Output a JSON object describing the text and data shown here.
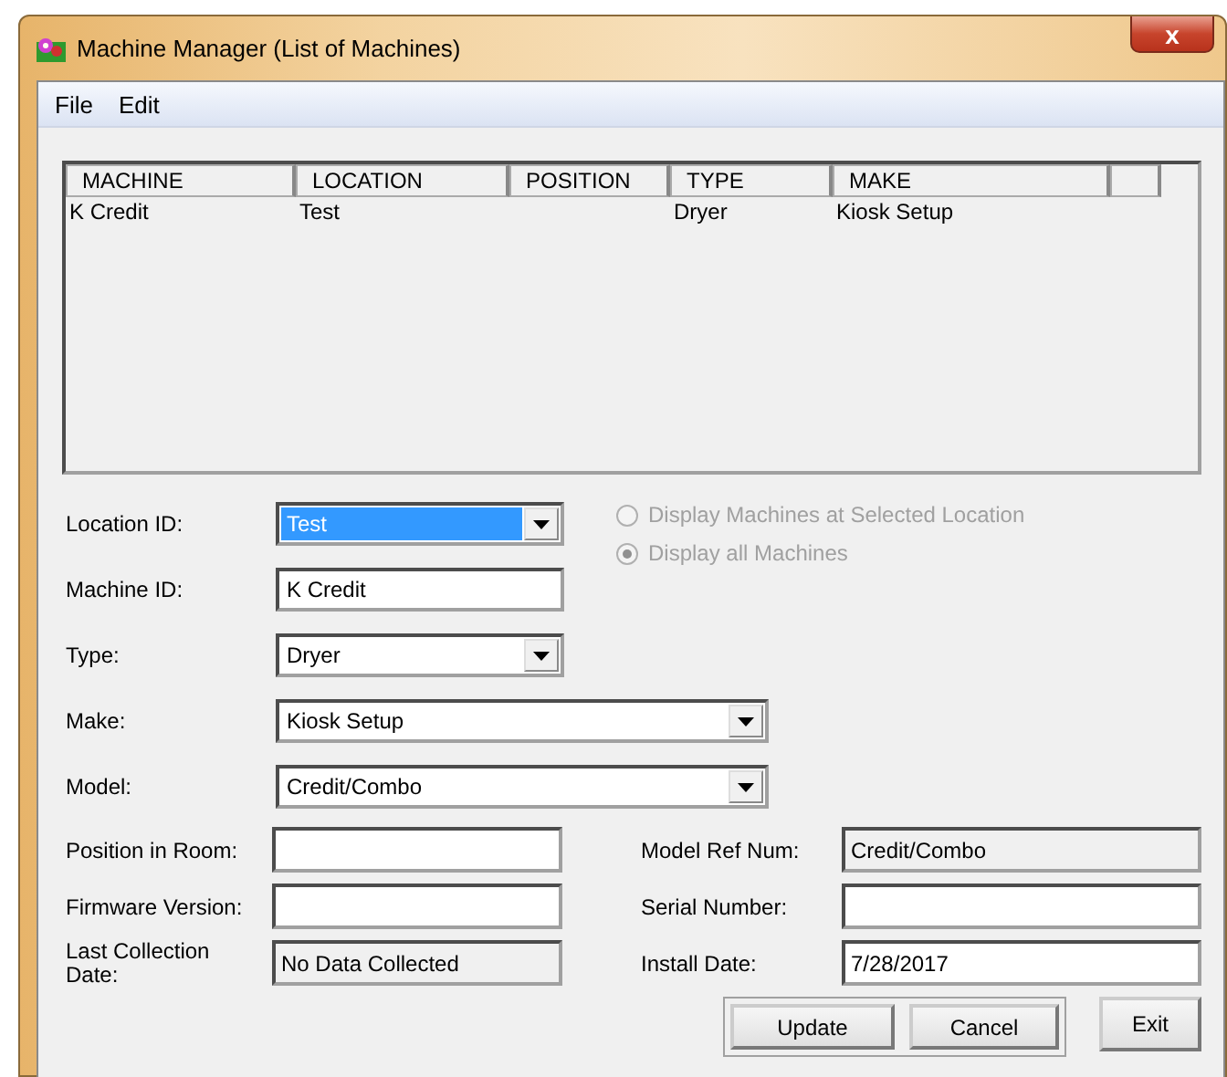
{
  "window": {
    "title": "Machine Manager (List of Machines)",
    "close": "x"
  },
  "menu": [
    {
      "label": "File"
    },
    {
      "label": "Edit"
    }
  ],
  "list": {
    "columns": [
      "MACHINE",
      "LOCATION",
      "POSITION",
      "TYPE",
      "MAKE"
    ],
    "rows": [
      {
        "cells": [
          "K Credit",
          "Test",
          null,
          "Dryer",
          "Kiosk Setup"
        ]
      }
    ]
  },
  "selectors": [
    {
      "label": "Location ID:",
      "kind": "combo",
      "value": "Test",
      "highlighted": true
    },
    {
      "label": "Machine ID:",
      "kind": "text",
      "value": "K Credit",
      "highlighted": false
    },
    {
      "label": "Type:",
      "kind": "combo",
      "value": "Dryer",
      "highlighted": false
    },
    {
      "label": "Make:",
      "kind": "combo",
      "value": "Kiosk Setup",
      "highlighted": false
    },
    {
      "label": "Model:",
      "kind": "combo",
      "value": "Credit/Combo",
      "highlighted": false
    }
  ],
  "display_options": [
    {
      "label": "Display Machines at Selected Location",
      "selected": false,
      "disabled": true
    },
    {
      "label": "Display all Machines",
      "selected": true,
      "disabled": true
    }
  ],
  "details": [
    {
      "label": "Position in Room:",
      "readonly": false
    },
    {
      "label": "Model Ref Num:",
      "value": "Credit/Combo",
      "readonly": true
    },
    {
      "label": "Firmware Version:",
      "readonly": false
    },
    {
      "label": "Serial Number:",
      "readonly": false
    },
    {
      "label": "Last Collection Date:",
      "value": "No Data Collected",
      "readonly": true
    },
    {
      "label": "Install Date:",
      "value": "7/28/2017",
      "readonly": false
    }
  ],
  "buttons": [
    {
      "label": "Update"
    },
    {
      "label": "Cancel"
    },
    {
      "label": "Exit"
    }
  ]
}
